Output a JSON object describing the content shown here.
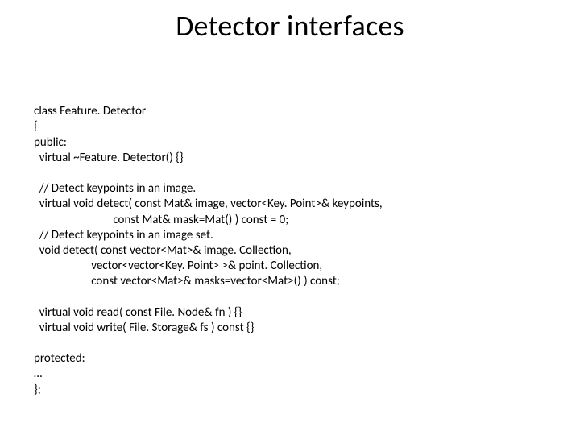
{
  "title": "Detector interfaces",
  "code": {
    "l1": "class Feature. Detector",
    "l2": "{",
    "l3": "public:",
    "l4": "  virtual ~Feature. Detector() {}",
    "l5": "",
    "l6": "  // Detect keypoints in an image.",
    "l7": "  virtual void detect( const Mat& image, vector<Key. Point>& keypoints,",
    "l8": "                             const Mat& mask=Mat() ) const = 0;",
    "l9": "  // Detect keypoints in an image set.",
    "l10": "  void detect( const vector<Mat>& image. Collection,",
    "l11": "                     vector<vector<Key. Point> >& point. Collection,",
    "l12": "                     const vector<Mat>& masks=vector<Mat>() ) const;",
    "l13": "",
    "l14": "  virtual void read( const File. Node& fn ) {}",
    "l15": "  virtual void write( File. Storage& fs ) const {}",
    "l16": "",
    "l17": "protected:",
    "l18": "…",
    "l19": "};"
  }
}
